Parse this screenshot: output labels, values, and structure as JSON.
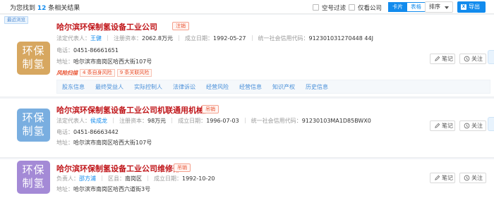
{
  "header": {
    "found_prefix": "为您找到",
    "found_count": "12",
    "found_suffix": "条相关结果",
    "filter_empty_phone": "空号过滤",
    "filter_only_view": "仅看公司",
    "view_card": "卡片",
    "view_table": "表格",
    "sort_label": "排序",
    "export_label": "导出",
    "export_icon": "excel-icon"
  },
  "results": [
    {
      "recent_tag": "最近浏览",
      "logo_text": [
        "环保",
        "制氢"
      ],
      "logo_color": "#d7a760",
      "name": "哈尔滨环保制氢设备工业公司",
      "status": "注销",
      "row1": [
        {
          "label": "法定代表人：",
          "value": "王健",
          "link": true
        },
        {
          "label": "注册资本：",
          "value": "2062.8万元"
        },
        {
          "label": "成立日期：",
          "value": "1992-05-27"
        },
        {
          "label": "统一社会信用代码：",
          "value": "912301031270448 44J"
        }
      ],
      "phone_label": "电话：",
      "phone": "0451-86661651",
      "address_label": "地址：",
      "address": "哈尔滨市南岗区哈西大街107号",
      "risk_logo": "风险扫描",
      "risks": [
        "4 条自身风险",
        "9 条关联风险"
      ],
      "tabs": [
        "股东信息",
        "最终受益人",
        "实际控制人",
        "法律诉讼",
        "经营风险",
        "经营信息",
        "知识产权",
        "历史信息"
      ],
      "note_label": "笔记",
      "follow_label": "关注"
    },
    {
      "logo_text": [
        "环保",
        "制氢"
      ],
      "logo_color": "#79aee0",
      "name": "哈尔滨环保制氢设备工业公司机联通用机械厂",
      "status": "吊销",
      "row1": [
        {
          "label": "法定代表人：",
          "value": "侯成龙",
          "link": true
        },
        {
          "label": "注册资本：",
          "value": "98万元"
        },
        {
          "label": "成立日期：",
          "value": "1996-07-03"
        },
        {
          "label": "统一社会信用代码：",
          "value": "91230103MA1D85BWX0"
        }
      ],
      "phone_label": "电话：",
      "phone": "0451-86663442",
      "address_label": "地址：",
      "address": "哈尔滨市南岗区哈西大街107号",
      "note_label": "笔记",
      "follow_label": "关注"
    },
    {
      "logo_text": [
        "环保",
        "制氢"
      ],
      "logo_color": "#a48ad6",
      "name": "哈尔滨环保制氢设备工业公司维修部",
      "status": "吊销",
      "row1": [
        {
          "label": "负责人：",
          "value": "邵方浦",
          "link": true
        },
        {
          "label": "区县：",
          "value": "南岗区"
        },
        {
          "label": "成立日期：",
          "value": "1992-10-20"
        }
      ],
      "address_label": "地址：",
      "address": "哈尔滨市南岗区哈西六道街3号",
      "note_label": "笔记",
      "follow_label": "关注"
    }
  ]
}
